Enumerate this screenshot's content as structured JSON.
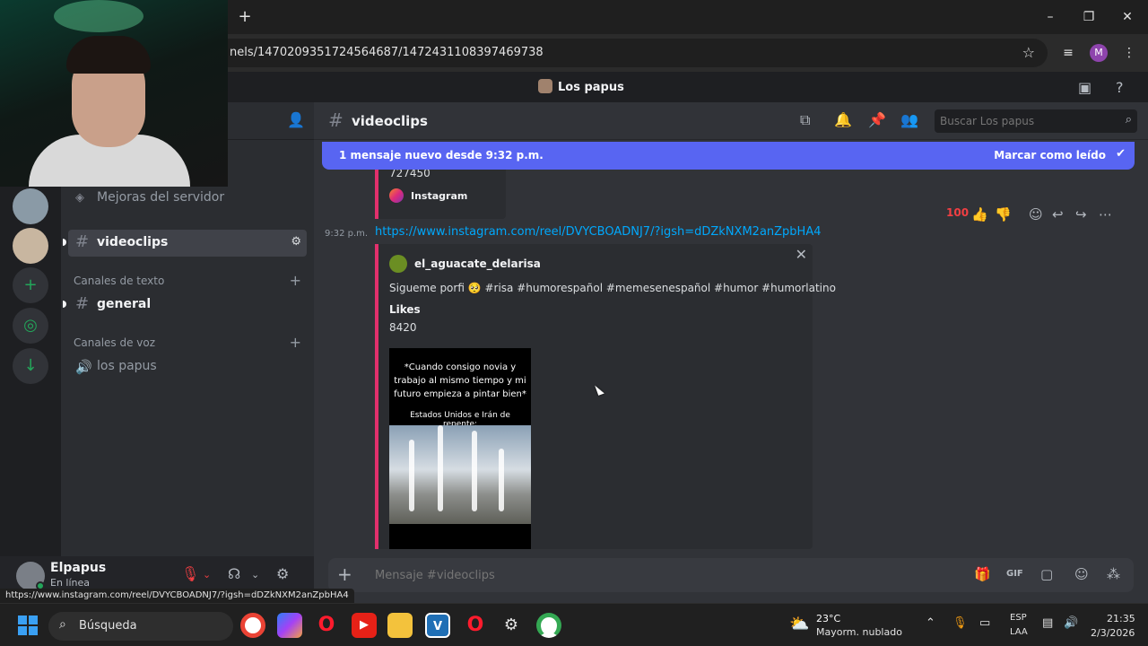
{
  "browser": {
    "new_tab": "+",
    "minimize": "–",
    "restore": "❐",
    "close": "✕",
    "address": "nels/1470209351724564687/1472431108397469738",
    "bookmark_star": "☆",
    "profile_initial": "M"
  },
  "discord": {
    "server_name": "Los papus",
    "sidebar": {
      "boosts_label": "Mejoras del servidor",
      "active_channel": "videoclips",
      "text_category": "Canales de texto",
      "text_channels": [
        "general"
      ],
      "voice_category": "Canales de voz",
      "voice_channels": [
        "los papus"
      ]
    },
    "user": {
      "name": "Elpapus",
      "status": "En línea"
    },
    "header": {
      "channel_name": "videoclips",
      "search_placeholder": "Buscar Los papus"
    },
    "banner": {
      "text": "1 mensaje nuevo desde 9:32 p.m.",
      "action": "Marcar como leído"
    },
    "previous_embed": {
      "value": "727450",
      "provider": "Instagram"
    },
    "message": {
      "timestamp": "9:32 p.m.",
      "link": "https://www.instagram.com/reel/DVYCBOADNJ7/?igsh=dDZkNXM2anZpbHA4",
      "embed": {
        "author": "el_aguacate_delarisa",
        "description": "Sigueme porfi 🥺 #risa #humorespañol #memesenespañol #humor #humorlatino",
        "field_name": "Likes",
        "field_value": "8420",
        "thumb_caption": "*Cuando consigo novia y trabajo al mismo tiempo y mi futuro empieza a pintar bien*",
        "thumb_caption2": "Estados Unidos e Irán de repente:"
      }
    },
    "composer_placeholder": "Mensaje #videoclips"
  },
  "status_url": "https://www.instagram.com/reel/DVYCBOADNJ7/?igsh=dDZkNXM2anZpbHA4",
  "taskbar": {
    "search_label": "Búsqueda",
    "weather_temp": "23°C",
    "weather_desc": "Mayorm. nublado",
    "lang_1": "ESP",
    "lang_2": "LAA",
    "time": "21:35",
    "date": "2/3/2026"
  }
}
